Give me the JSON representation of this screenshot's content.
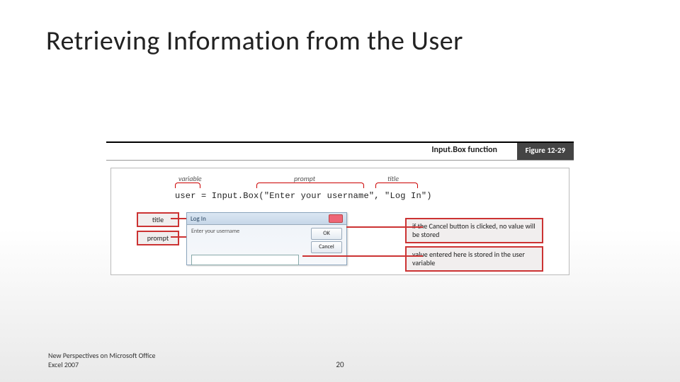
{
  "slide": {
    "title": "Retrieving Information from the User",
    "footer_left_l1": "New Perspectives on Microsoft Office",
    "footer_left_l2": "Excel 2007",
    "page_number": "20"
  },
  "figure": {
    "caption": "Input.Box function",
    "number": "Figure 12-29",
    "code": "user = Input.Box(\"Enter your username\", \"Log In\")",
    "segments": {
      "variable": "variable",
      "prompt": "prompt",
      "title": "title"
    }
  },
  "dialog": {
    "title": "Log In",
    "prompt": "Enter your username",
    "ok": "OK",
    "cancel": "Cancel",
    "input_value": ""
  },
  "tags": {
    "title": "title",
    "prompt": "prompt"
  },
  "callouts": {
    "cancel_note": "if the Cancel button is clicked, no value will be stored",
    "value_note": "value entered here is stored in the user variable"
  }
}
